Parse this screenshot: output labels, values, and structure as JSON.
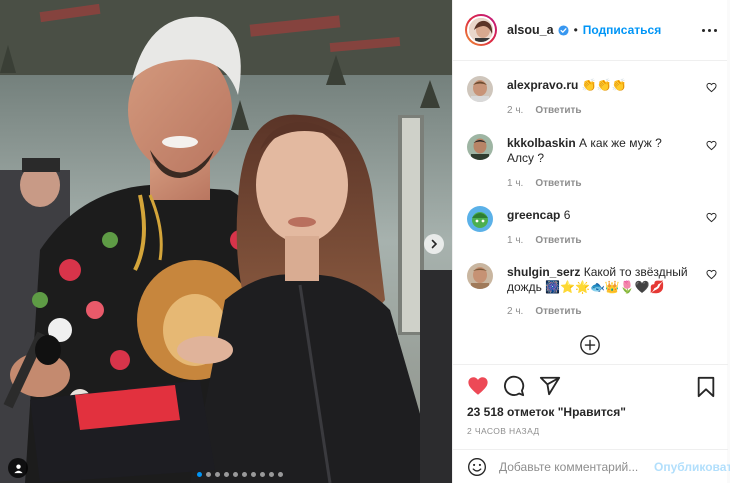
{
  "post": {
    "author": "alsou_a",
    "separator": "•",
    "follow_label": "Подписаться",
    "carousel": {
      "slides": 10,
      "active_index": 0
    },
    "icons": {
      "verified": "verified-badge-icon",
      "more": "more-options-icon",
      "next": "chevron-right-icon",
      "tag": "user-tag-icon"
    }
  },
  "comments": [
    {
      "user": "alexpravo.ru",
      "text": "👏👏👏",
      "time": "2 ч.",
      "reply": "Ответить"
    },
    {
      "user": "kkkolbaskin",
      "text": "А как же муж ? Алсу ?",
      "time": "1 ч.",
      "reply": "Ответить"
    },
    {
      "user": "greencap",
      "text": "6",
      "time": "1 ч.",
      "reply": "Ответить"
    },
    {
      "user": "shulgin_serz",
      "text": "Какой то звёздный дождь 🎆⭐🌟🐟👑🌷🖤💋",
      "time": "2 ч.",
      "reply": "Ответить"
    }
  ],
  "actions": {
    "likes_text": "23 518 отметок \"Нравится\"",
    "time_ago": "2 ЧАСОВ НАЗАД",
    "liked": true,
    "like_color": "#ed4956"
  },
  "composer": {
    "placeholder": "Добавьте комментарий...",
    "publish_label": "Опубликовать"
  }
}
